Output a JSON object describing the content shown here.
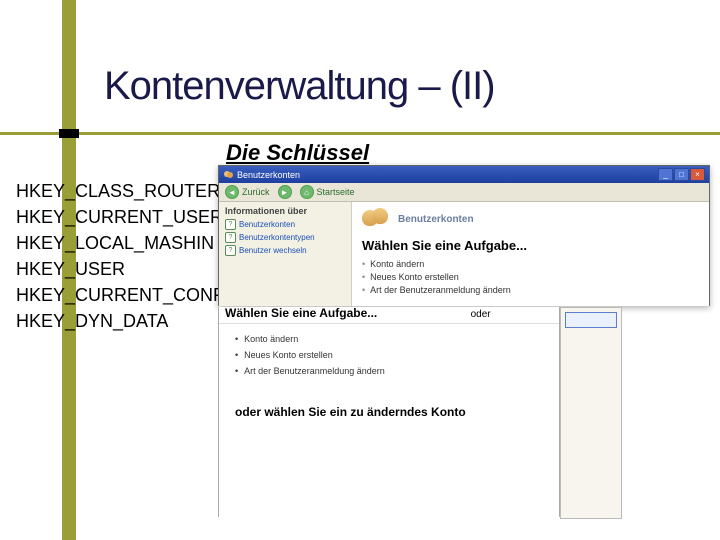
{
  "title": "Kontenverwaltung – (II)",
  "subtitle": "Die Schlüssel",
  "keys": [
    "HKEY_CLASS_ROUTER",
    "HKEY_CURRENT_USER",
    "HKEY_LOCAL_MASHIN",
    "HKEY_USER",
    "HKEY_CURRENT_CONF",
    "HKEY_DYN_DATA"
  ],
  "win1": {
    "title": "Benutzerkonten",
    "toolbar": {
      "back": "Zurück",
      "home": "Startseite"
    },
    "side_heading": "Informationen über",
    "side_items": [
      "Benutzerkonten",
      "Benutzerkontentypen",
      "Benutzer wechseln"
    ],
    "main_label": "Benutzerkonten",
    "heading": "Wählen Sie eine Aufgabe...",
    "tasks": [
      "Konto ändern",
      "Neues Konto erstellen",
      "Art der Benutzeranmeldung ändern"
    ]
  },
  "pane2": {
    "cut_text": "Wählen Sie eine Aufgabe...",
    "oder": "oder",
    "tasks": [
      "Konto ändern",
      "Neues Konto erstellen",
      "Art der Benutzeranmeldung ändern"
    ],
    "footer": "oder wählen Sie ein zu änderndes Konto"
  }
}
